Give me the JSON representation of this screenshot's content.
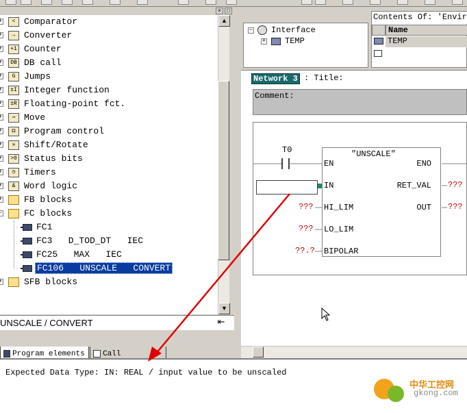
{
  "tree": {
    "items": [
      {
        "label": "Comparator",
        "icon": "<"
      },
      {
        "label": "Converter",
        "icon": "→"
      },
      {
        "label": "Counter",
        "icon": "+1"
      },
      {
        "label": "DB call",
        "icon": "DB"
      },
      {
        "label": "Jumps",
        "icon": "G"
      },
      {
        "label": "Integer function",
        "icon": "±I"
      },
      {
        "label": "Floating-point fct.",
        "icon": "±R"
      },
      {
        "label": "Move",
        "icon": "⇒"
      },
      {
        "label": "Program control",
        "icon": "◘"
      },
      {
        "label": "Shift/Rotate",
        "icon": "»"
      },
      {
        "label": "Status bits",
        "icon": ">0"
      },
      {
        "label": "Timers",
        "icon": "◷"
      },
      {
        "label": "Word logic",
        "icon": "&"
      },
      {
        "label": "FB blocks",
        "icon": ""
      },
      {
        "label": "FC blocks",
        "icon": ""
      }
    ],
    "fc_children": [
      {
        "label": "FC1"
      },
      {
        "label": "FC3   D_TOD_DT   IEC"
      },
      {
        "label": "FC25   MAX   IEC"
      },
      {
        "label": "FC106   UNSCALE   CONVERT"
      }
    ],
    "last_item": "SFB blocks",
    "status_text": "UNSCALE / CONVERT"
  },
  "tabs": {
    "program_elements": "Program elements",
    "call_structure": "Call structure"
  },
  "interface": {
    "root": "Interface",
    "child": "TEMP"
  },
  "contents": {
    "title": "Contents Of: 'Enviro",
    "col_name": "Name",
    "row1": "TEMP"
  },
  "network": {
    "label": "Network 3",
    "title_label": ": Title:",
    "comment_label": "Comment:",
    "contact_label": "T0",
    "block_name": "\"UNSCALE\"",
    "pins_left": [
      "EN",
      "IN",
      "HI_LIM",
      "LO_LIM",
      "BIPOLAR"
    ],
    "pins_right": [
      "ENO",
      "RET_VAL",
      "OUT"
    ],
    "val_hi": "???",
    "val_lo": "???",
    "val_bipolar": "??.?",
    "val_retval": "???",
    "val_out": "???"
  },
  "message": {
    "text": "Expected Data Type: IN: REAL /  input value to be unscaled"
  },
  "watermark": {
    "cn": "中华工控网",
    "url": "gkong.com"
  },
  "colors": {
    "accent": "#0a3ca0",
    "arrow": "#e00000",
    "comment_bg": "#c0c0c0"
  }
}
